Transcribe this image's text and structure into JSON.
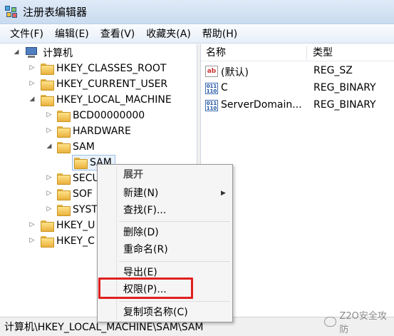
{
  "window": {
    "title": "注册表编辑器"
  },
  "menubar": [
    "文件(F)",
    "编辑(E)",
    "查看(V)",
    "收藏夹(A)",
    "帮助(H)"
  ],
  "tree": {
    "root": "计算机",
    "hkcr": "HKEY_CLASSES_ROOT",
    "hkcu": "HKEY_CURRENT_USER",
    "hklm": "HKEY_LOCAL_MACHINE",
    "bcd": "BCD00000000",
    "hardware": "HARDWARE",
    "sam_parent": "SAM",
    "sam_child": "SAM",
    "security_partial": "SECU",
    "software_partial": "SOF",
    "system_partial": "SYST",
    "hku_partial": "HKEY_U",
    "hkcc_partial": "HKEY_C"
  },
  "list": {
    "col_name": "名称",
    "col_type": "类型",
    "rows": [
      {
        "name": "(默认)",
        "type": "REG_SZ",
        "icon": "ab"
      },
      {
        "name": "C",
        "type": "REG_BINARY",
        "icon": "binary"
      },
      {
        "name": "ServerDomain...",
        "type": "REG_BINARY",
        "icon": "binary"
      }
    ]
  },
  "context_menu": {
    "expand": "展开",
    "new": "新建(N)",
    "find": "查找(F)...",
    "delete": "删除(D)",
    "rename": "重命名(R)",
    "export": "导出(E)",
    "permissions": "权限(P)...",
    "copy_key_name": "复制项名称(C)"
  },
  "statusbar": {
    "path": "计算机\\HKEY_LOCAL_MACHINE\\SAM\\SAM"
  },
  "watermark": {
    "text": "Z2O安全攻防"
  },
  "colors": {
    "highlight_box": "#e02020",
    "selection": "#e8f1fb"
  }
}
